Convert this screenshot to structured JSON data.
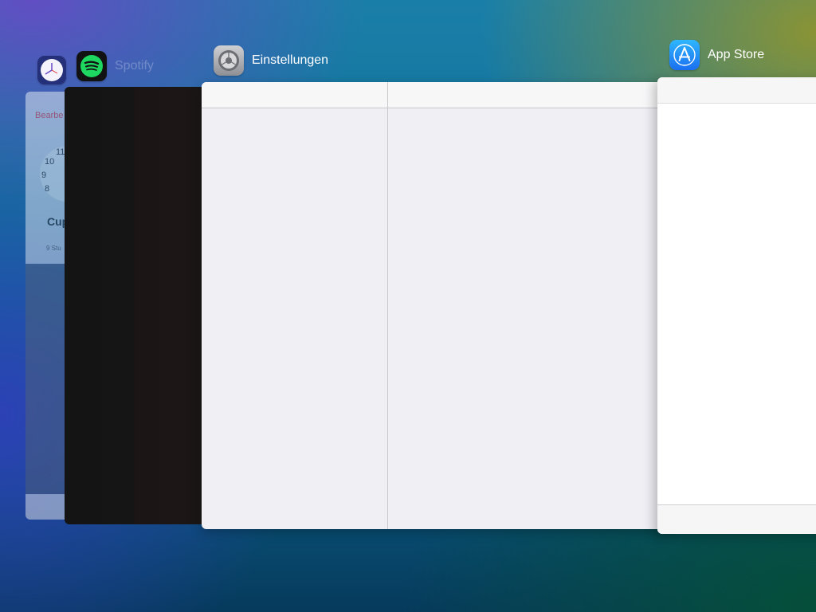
{
  "switcher": {
    "apps": [
      {
        "name": "",
        "icon": "clock-icon"
      },
      {
        "name": "Spotify",
        "icon": "spotify-icon"
      },
      {
        "name": "Einstellungen",
        "icon": "gear-icon"
      },
      {
        "name": "App Store",
        "icon": "app-store-icon"
      }
    ]
  },
  "clock_card": {
    "tab_label": "Bearbe",
    "numbers": [
      "11",
      "10",
      "9",
      "8"
    ],
    "city": "Cup",
    "sub": "9 Stu"
  },
  "colors": {
    "spotify_green": "#1ed760",
    "appstore_blue": "#1a8cff"
  }
}
